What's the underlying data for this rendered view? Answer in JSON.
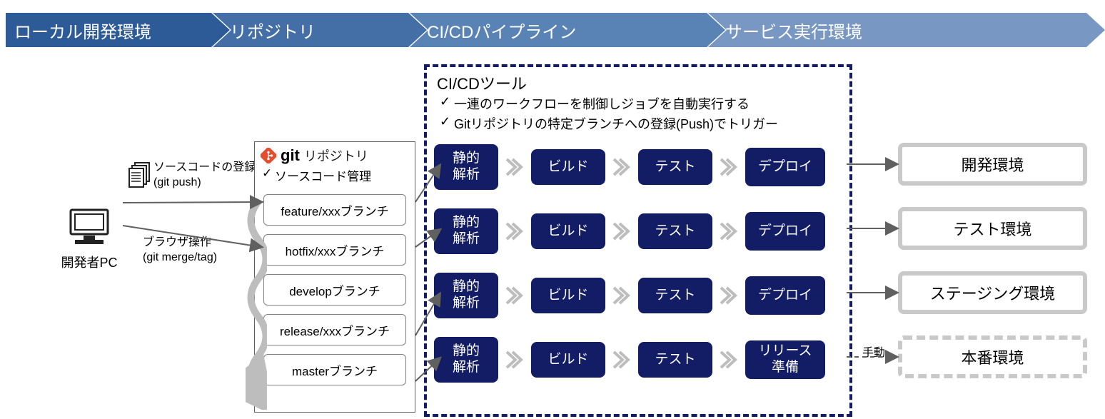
{
  "banner": {
    "c1": "ローカル開発環境",
    "c2": "リポジトリ",
    "c3": "CI/CDパイプライン",
    "c4": "サービス実行環境"
  },
  "pc": {
    "label": "開発者PC"
  },
  "push": {
    "line1": "ソースコードの登録",
    "line2": "(git push)"
  },
  "browser": {
    "line1": "ブラウザ操作",
    "line2": "(git merge/tag)"
  },
  "repo": {
    "git_word": "git",
    "title": "リポジトリ",
    "subtitle": "ソースコード管理",
    "branches": [
      "feature/xxxブランチ",
      "hotfix/xxxブランチ",
      "developブランチ",
      "release/xxxブランチ",
      "masterブランチ"
    ]
  },
  "cicd": {
    "title": "CI/CDツール",
    "bullets": [
      "一連のワークフローを制御しジョブを自動実行する",
      "Gitリポジトリの特定ブランチへの登録(Push)でトリガー"
    ],
    "stage_static": "静的\n解析",
    "stage_build": "ビルド",
    "stage_test": "テスト",
    "stage_deploy": "デプロイ",
    "stage_release": "リリース\n準備"
  },
  "envs": {
    "dev": "開発環境",
    "test": "テスト環境",
    "staging": "ステージング環境",
    "prod": "本番環境"
  },
  "manual_label": "手動",
  "colors": {
    "navy": "#131d66"
  }
}
